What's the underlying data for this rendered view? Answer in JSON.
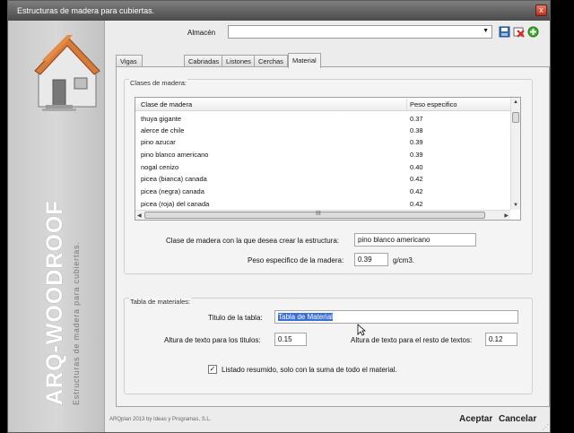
{
  "window": {
    "title": "Estructuras de madera para cubiertas.",
    "close_label": "x"
  },
  "brand": {
    "name": "ARQ-WOODROOF",
    "subtitle": "Estructuras de madera para cubiertas.",
    "credit": "ARQplan 2013 by Ideas y Programas, S.L."
  },
  "toolbar": {
    "almacen_label": "Almacén",
    "almacen_value": "",
    "icons": [
      "save-icon",
      "delete-icon",
      "add-icon"
    ]
  },
  "tabs": [
    {
      "label": "Vigas de apoyo",
      "active": false
    },
    {
      "label": "Cabriadas",
      "active": false
    },
    {
      "label": "Listones",
      "active": false
    },
    {
      "label": "Cerchas",
      "active": false
    },
    {
      "label": "Material",
      "active": true
    }
  ],
  "clases": {
    "group_title": "Clases de madera:",
    "columns": [
      "Clase de madera",
      "Peso especifico"
    ],
    "rows": [
      [
        "thuya gigante",
        "0.37"
      ],
      [
        "alerce de chile",
        "0.38"
      ],
      [
        "pino azucar",
        "0.39"
      ],
      [
        "pino blanco americano",
        "0.39"
      ],
      [
        "nogal cenizo",
        "0.40"
      ],
      [
        "picea (bianca) canada",
        "0.42"
      ],
      [
        "picea (negra) canada",
        "0.42"
      ],
      [
        "picea (roja) del canada",
        "0.42"
      ]
    ],
    "scroll_grip": "III",
    "estructura_label": "Clase de madera con la que desea crear la estructura:",
    "estructura_value": "pino blanco americano",
    "peso_label": "Peso especifico de la madera:",
    "peso_value": "0.39",
    "peso_unit": "g/cm3."
  },
  "tabla": {
    "group_title": "Tabla de materiales:",
    "titulo_label": "Titulo de la tabla:",
    "titulo_value": "Tabla de Material",
    "altura_titulos_label": "Altura de texto para los titulos:",
    "altura_titulos_value": "0.15",
    "altura_resto_label": "Altura de texto para el resto de textos:",
    "altura_resto_value": "0.12",
    "listado_label": "Listado resumido, solo con la suma de todo el material.",
    "listado_checked": true,
    "check_mark": "✓"
  },
  "actions": {
    "accept_label": "Aceptar",
    "cancel_label": "Cancelar"
  },
  "colors": {
    "title_bar": "#5f5f5f",
    "selection": "#3a6ed8"
  }
}
